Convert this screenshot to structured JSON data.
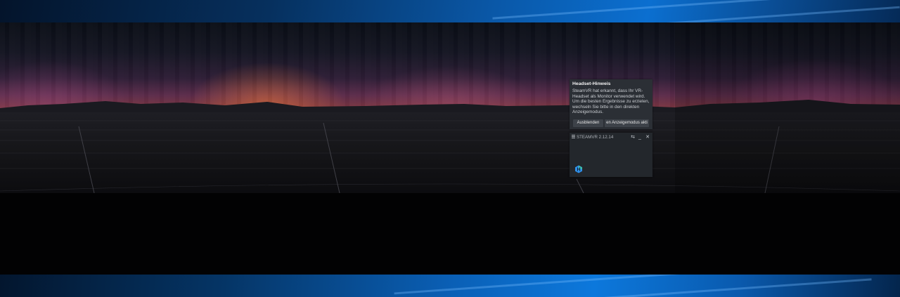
{
  "notice": {
    "title": "Headset-Hinweis",
    "body": "SteamVR hat erkannt, dass Ihr VR-Headset als Monitor verwendet wird. Um die besten Ergebnisse zu erzielen, wechseln Sie bitte in den direkten Anzeigemodus.",
    "hide_label": "Ausblenden",
    "direct_mode_label": "en Anzeigemodus akti"
  },
  "steamvr": {
    "title": "STEAMVR 2.12.14",
    "menu_icon": "hamburger-menu-icon",
    "restore_glyph": "⇆",
    "minimize_glyph": "_",
    "close_glyph": "✕",
    "device_icon": "headset-icon",
    "device_letter": "H"
  },
  "colors": {
    "dialog_bg": "#2b2f35",
    "status_bg": "#23272c",
    "button_bg": "#3d4249",
    "headset_icon_blue": "#2f8fe8",
    "headset_icon_green": "#3ec6a5"
  }
}
